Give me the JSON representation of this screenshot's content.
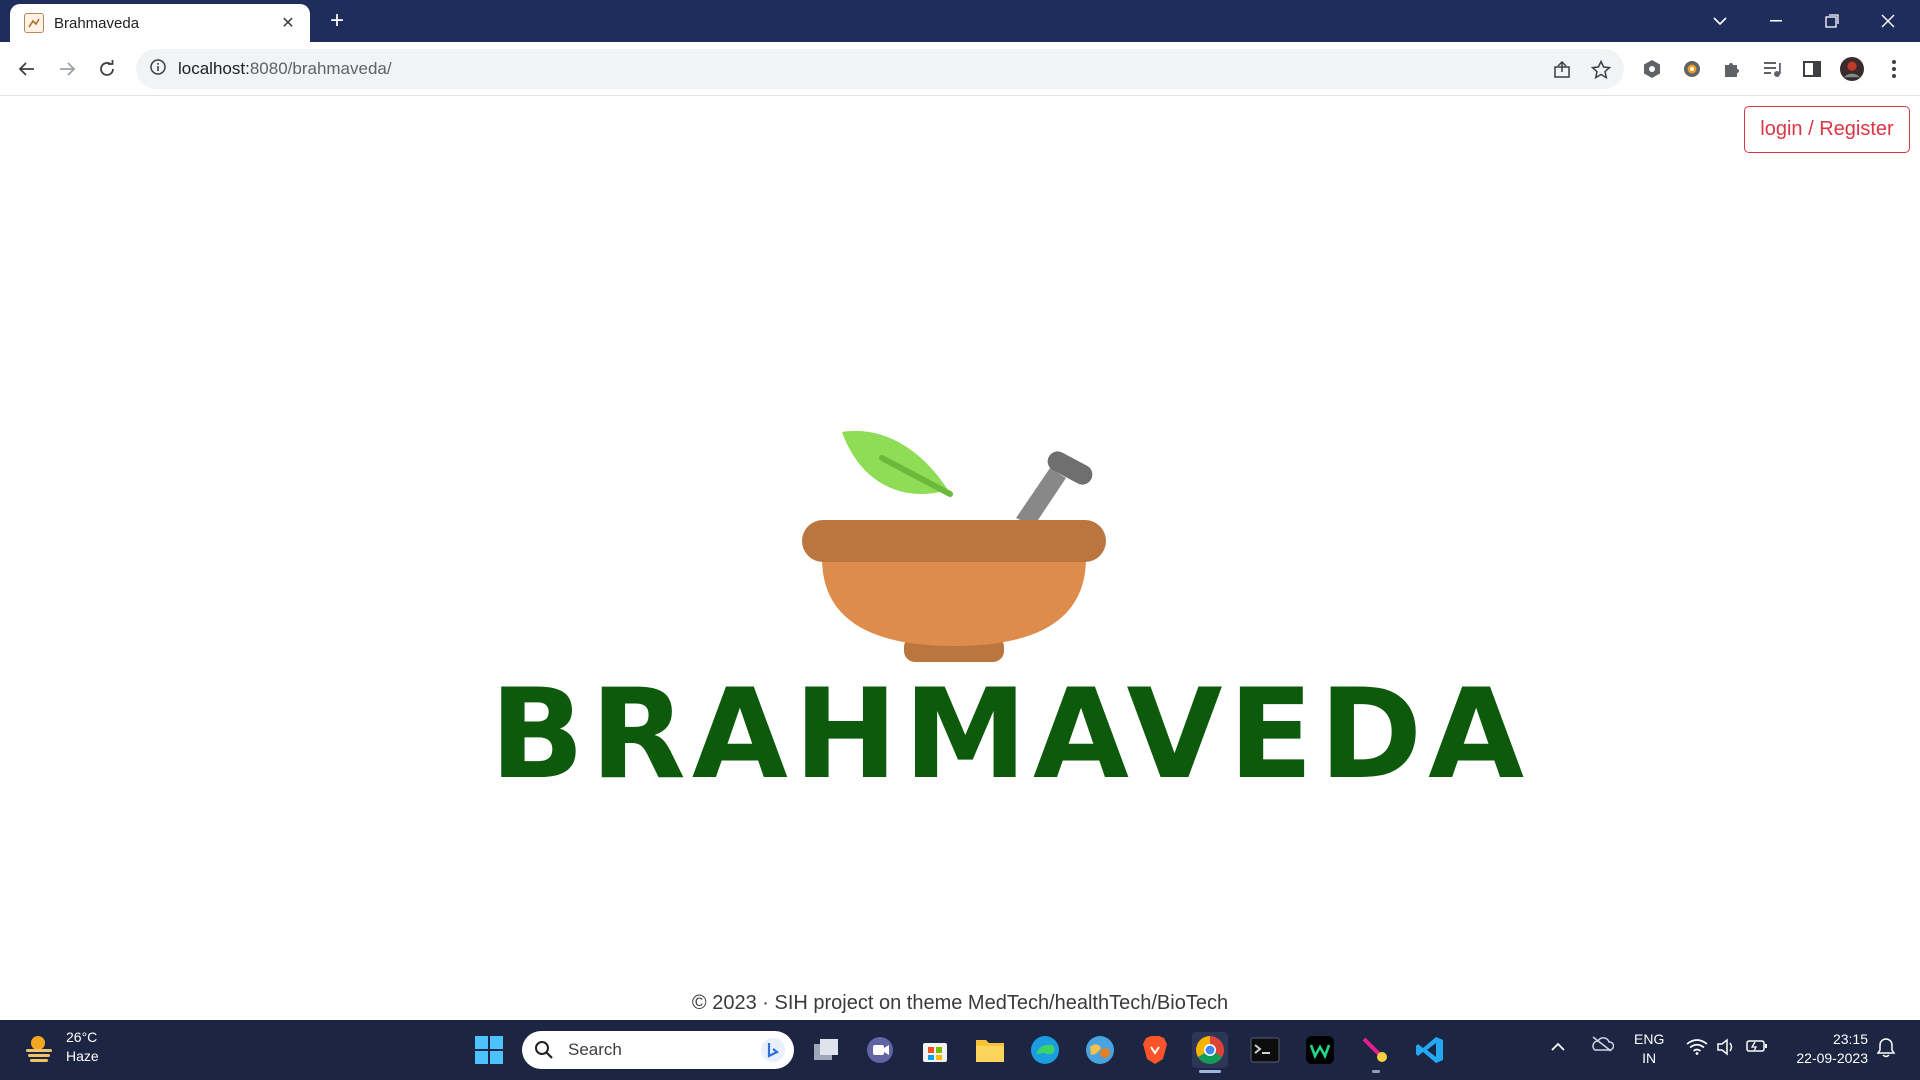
{
  "browser": {
    "tab_title": "Brahmaveda",
    "url_host": "localhost:",
    "url_path": "8080/brahmaveda/",
    "icons": [
      "favicon",
      "close-icon",
      "new-tab-icon",
      "tab-search-icon",
      "minimize-icon",
      "restore-icon",
      "window-close-icon",
      "back-icon",
      "forward-icon",
      "reload-icon",
      "site-info-icon",
      "share-icon",
      "bookmark-star-icon",
      "extension-icon",
      "puzzle-icon",
      "media-icon",
      "side-panel-icon",
      "profile-avatar",
      "menu-icon"
    ]
  },
  "page": {
    "login_label": "login / Register",
    "brand_name": "BRAHMAVEDA",
    "footer_text": "© 2023 · SIH project on theme MedTech/healthTech/BioTech",
    "colors": {
      "brand_green": "#0d5a0d",
      "login_red": "#dc3545",
      "bowl": "#de8c4c",
      "bowl_rim": "#bb7640",
      "leaf": "#8fdc57",
      "pestle": "#8a8a8a"
    }
  },
  "taskbar": {
    "weather_temp": "26°C",
    "weather_desc": "Haze",
    "search_placeholder": "Search",
    "lang_top": "ENG",
    "lang_bottom": "IN",
    "time": "23:15",
    "date": "22-09-2023",
    "colors": {
      "background": "#1c2541"
    }
  }
}
